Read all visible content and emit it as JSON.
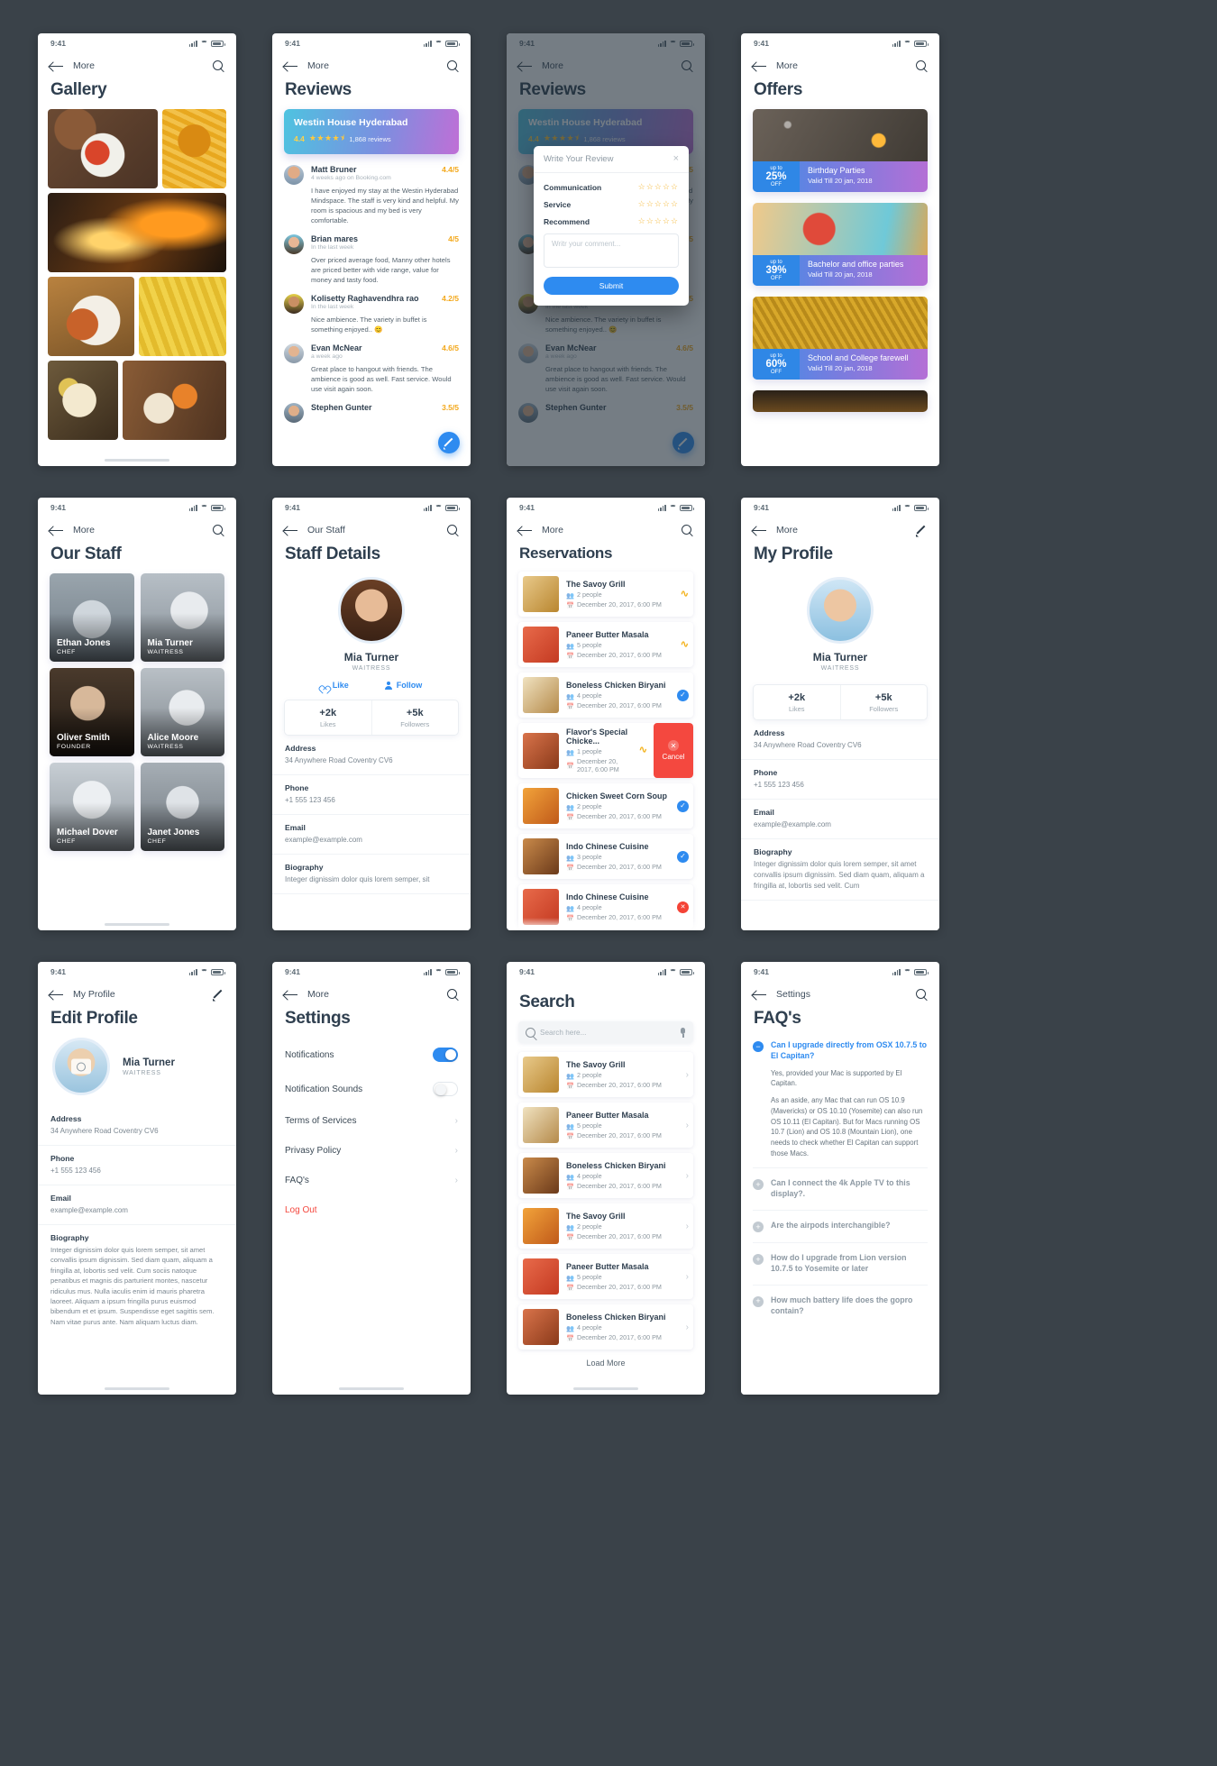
{
  "status_bar": {
    "time": "9:41"
  },
  "common": {
    "nav_more": "More",
    "search_icon": "search-icon",
    "back_icon": "back-arrow-icon"
  },
  "screens": {
    "gallery": {
      "nav": "More",
      "title": "Gallery"
    },
    "reviews": {
      "nav": "More",
      "title": "Reviews",
      "banner": {
        "name": "Westin House Hyderabad",
        "score": "4.4",
        "stars": "★★★★⯨",
        "count": "1,868 reviews"
      },
      "items": [
        {
          "name": "Matt Bruner",
          "when": "4 weeks ago on Booking.com",
          "rating": "4.4/5",
          "text": "I have enjoyed my stay at the Westin Hyderabad Mindspace. The staff is very kind and helpful. My room is spacious and my bed is very comfortable."
        },
        {
          "name": "Brian mares",
          "when": "In the last week",
          "rating": "4/5",
          "text": "Over priced average food, Manny other hotels are priced better with vide range, value for money and tasty food."
        },
        {
          "name": "Kolisetty Raghavendhra rao",
          "when": "In the last week",
          "rating": "4.2/5",
          "text": "Nice ambience. The variety in buffet is something enjoyed.. 😊"
        },
        {
          "name": "Evan McNear",
          "when": "a week ago",
          "rating": "4.6/5",
          "text": "Great place to hangout with friends.  The ambience is good as well. Fast service. Would use visit again soon."
        },
        {
          "name": "Stephen Gunter",
          "when": "",
          "rating": "3.5/5",
          "text": ""
        }
      ],
      "fab_icon": "write-review-icon"
    },
    "write_review": {
      "nav": "More",
      "title": "Reviews",
      "modal": {
        "title": "Write Your Review",
        "close": "×",
        "rows": [
          {
            "label": "Communication",
            "stars": "☆☆☆☆☆"
          },
          {
            "label": "Service",
            "stars": "☆☆☆☆☆"
          },
          {
            "label": "Recommend",
            "stars": "☆☆☆☆☆"
          }
        ],
        "comment_placeholder": "Writr your comment...",
        "submit": "Submit"
      }
    },
    "offers": {
      "nav": "More",
      "title": "Offers",
      "items": [
        {
          "up": "up to",
          "pct": "25%",
          "off": "OFF",
          "title": "Birthday Parties",
          "valid": "Valid Till 20 jan, 2018"
        },
        {
          "up": "up to",
          "pct": "39%",
          "off": "OFF",
          "title": "Bachelor and office parties",
          "valid": "Valid Till 20 jan, 2018"
        },
        {
          "up": "up to",
          "pct": "60%",
          "off": "OFF",
          "title": "School and College farewell",
          "valid": "Valid Till 20 jan, 2018"
        }
      ]
    },
    "our_staff": {
      "nav": "More",
      "title": "Our Staff",
      "members": [
        {
          "name": "Ethan Jones",
          "role": "CHEF"
        },
        {
          "name": "Mia Turner",
          "role": "WAITRESS"
        },
        {
          "name": "Oliver Smith",
          "role": "FOUNDER"
        },
        {
          "name": "Alice Moore",
          "role": "WAITRESS"
        },
        {
          "name": "Michael Dover",
          "role": "CHEF"
        },
        {
          "name": "Janet Jones",
          "role": "CHEF"
        }
      ]
    },
    "staff_details": {
      "nav": "Our Staff",
      "title": "Staff Details",
      "name": "Mia Turner",
      "role": "WAITRESS",
      "like": "Like",
      "follow": "Follow",
      "stats": [
        {
          "value": "+2k",
          "label": "Likes"
        },
        {
          "value": "+5k",
          "label": "Followers"
        }
      ],
      "fields": [
        {
          "label": "Address",
          "value": "34 Anywhere Road Coventry CV6"
        },
        {
          "label": "Phone",
          "value": "+1 555 123 456"
        },
        {
          "label": "Email",
          "value": "example@example.com"
        },
        {
          "label": "Biography",
          "value": "Integer dignissim dolor quis lorem semper, sit"
        }
      ]
    },
    "reservations": {
      "nav": "More",
      "title": "Reservations",
      "cancel_label": "Cancel",
      "items": [
        {
          "title": "The Savoy Grill",
          "people": "2 people",
          "date": "December 20, 2017, 6:00 PM",
          "status": "pending"
        },
        {
          "title": "Paneer Butter Masala",
          "people": "5 people",
          "date": "December 20, 2017, 6:00 PM",
          "status": "pending"
        },
        {
          "title": "Boneless Chicken Biryani",
          "people": "4 people",
          "date": "December 20, 2017, 6:00 PM",
          "status": "confirmed"
        },
        {
          "title": "Flavor's Special Chicke...",
          "people": "1 people",
          "date": "December 20, 2017, 6:00 PM",
          "status": "cancel-open"
        },
        {
          "title": "Chicken Sweet Corn Soup",
          "people": "2 people",
          "date": "December 20, 2017, 6:00 PM",
          "status": "confirmed"
        },
        {
          "title": "Indo Chinese Cuisine",
          "people": "3 people",
          "date": "December 20, 2017, 6:00 PM",
          "status": "confirmed"
        },
        {
          "title": "Indo Chinese Cuisine",
          "people": "4 people",
          "date": "December 20, 2017, 6:00 PM",
          "status": "declined"
        }
      ]
    },
    "my_profile": {
      "nav": "More",
      "title": "My Profile",
      "name": "Mia Turner",
      "role": "WAITRESS",
      "stats": [
        {
          "value": "+2k",
          "label": "Likes"
        },
        {
          "value": "+5k",
          "label": "Followers"
        }
      ],
      "fields": [
        {
          "label": "Address",
          "value": "34 Anywhere Road Coventry CV6"
        },
        {
          "label": "Phone",
          "value": "+1 555 123 456"
        },
        {
          "label": "Email",
          "value": "example@example.com"
        },
        {
          "label": "Biography",
          "value": "Integer dignissim dolor quis lorem semper, sit amet convallis ipsum dignissim. Sed diam quam, aliquam a fringilla at, lobortis sed velit. Cum"
        }
      ]
    },
    "edit_profile": {
      "nav": "My Profile",
      "title": "Edit Profile",
      "name": "Mia Turner",
      "role": "WAITRESS",
      "fields": [
        {
          "label": "Address",
          "value": "34 Anywhere Road Coventry CV6"
        },
        {
          "label": "Phone",
          "value": "+1 555 123 456"
        },
        {
          "label": "Email",
          "value": "example@example.com"
        },
        {
          "label": "Biography",
          "value": "Integer dignissim dolor quis lorem semper, sit amet convallis ipsum dignissim. Sed diam quam, aliquam a fringilla at, lobortis sed velit. Cum sociis natoque penatibus et magnis dis parturient montes, nascetur ridiculus mus. Nulla iaculis enim id mauris pharetra laoreet. Aliquam a ipsum fringilla purus euismod bibendum et et ipsum. Suspendisse eget sagittis sem. Nam vitae purus ante. Nam aliquam luctus diam."
        }
      ]
    },
    "settings": {
      "nav": "More",
      "title": "Settings",
      "items": [
        {
          "label": "Notifications",
          "type": "toggle",
          "value": "on"
        },
        {
          "label": "Notification Sounds",
          "type": "toggle",
          "value": "off"
        },
        {
          "label": "Terms of Services",
          "type": "link"
        },
        {
          "label": "Privasy Policy",
          "type": "link"
        },
        {
          "label": "FAQ's",
          "type": "link"
        },
        {
          "label": "Log Out",
          "type": "danger"
        }
      ]
    },
    "search": {
      "nav": "",
      "title": "Search",
      "placeholder": "Search here...",
      "load_more": "Load More",
      "items": [
        {
          "title": "The Savoy Grill",
          "people": "2 people",
          "date": "December 20, 2017, 6:00 PM"
        },
        {
          "title": "Paneer Butter Masala",
          "people": "5 people",
          "date": "December 20, 2017, 6:00 PM"
        },
        {
          "title": "Boneless Chicken Biryani",
          "people": "4 people",
          "date": "December 20, 2017, 6:00 PM"
        },
        {
          "title": "The Savoy Grill",
          "people": "2 people",
          "date": "December 20, 2017, 6:00 PM"
        },
        {
          "title": "Paneer Butter Masala",
          "people": "5 people",
          "date": "December 20, 2017, 6:00 PM"
        },
        {
          "title": "Boneless Chicken Biryani",
          "people": "4 people",
          "date": "December 20, 2017, 6:00 PM"
        }
      ]
    },
    "faq": {
      "nav": "Settings",
      "title": "FAQ's",
      "open_item": {
        "question": "Can I upgrade directly from OSX 10.7.5 to El Capitan?",
        "answers": [
          "Yes, provided your Mac is supported by El Capitan.",
          "As an aside, any Mac that can run OS 10.9 (Mavericks) or OS 10.10 (Yosemite) can also run OS 10.11 (El Capitan). But for Macs running OS 10.7 (Lion) and OS 10.8 (Mountain Lion), one needs to check whether El Capitan can support those Macs."
        ]
      },
      "closed_items": [
        "Can I connect the 4k Apple TV to this display?.",
        "Are the airpods interchangible?",
        "How do I upgrade from Lion version 10.7.5 to Yosemite or later",
        "How much battery life does the gopro contain?"
      ]
    }
  }
}
